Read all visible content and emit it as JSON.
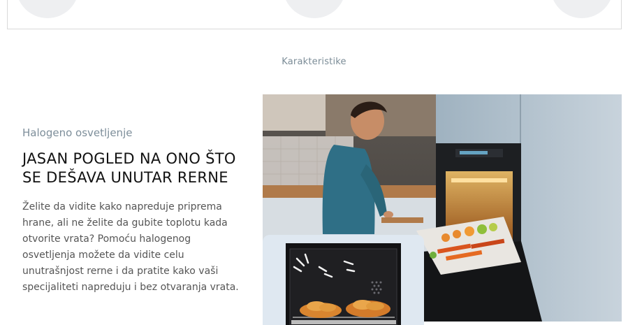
{
  "features": {
    "section_label": "Karakteristike",
    "eyebrow": "Halogeno osvetljenje",
    "headline": "JASAN POGLED NA ONO ŠTO SE DEŠAVA UNUTAR RERNE",
    "body": "Želite da vidite kako napreduje priprema hrane, ali ne želite da gubite toplotu kada otvorite vrata? Pomoću halogenog osvetljenja možete da vidite celu unutrašnjost rerne i da pratite kako vaši specijaliteti napreduju i bez otvaranja vrata."
  }
}
